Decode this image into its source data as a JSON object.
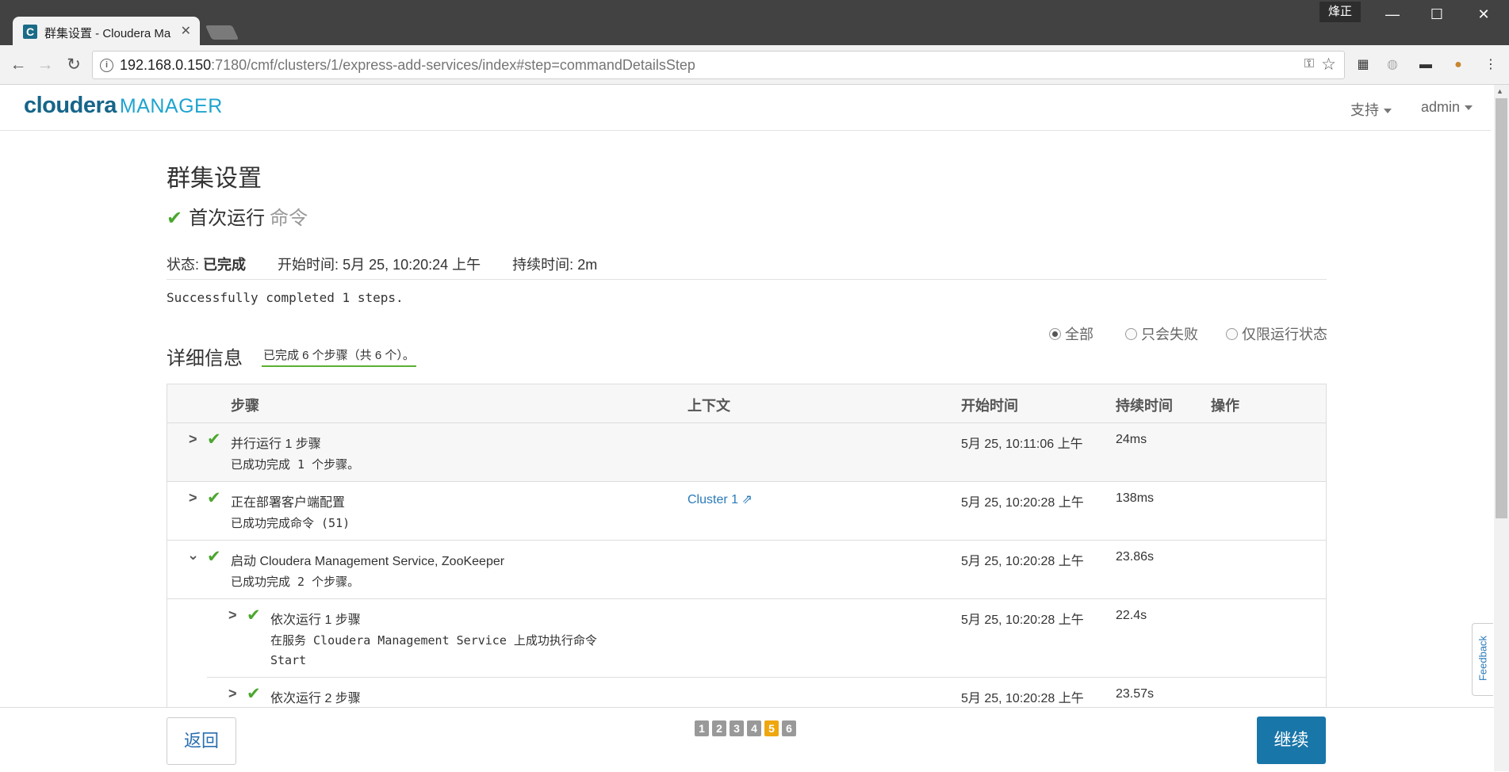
{
  "browser": {
    "tab_title": "群集设置 - Cloudera Ma",
    "profile_name": "烽正",
    "url_host": "192.168.0.150",
    "url_rest": ":7180/cmf/clusters/1/express-add-services/index#step=commandDetailsStep"
  },
  "header": {
    "logo_brand": "cloudera",
    "logo_product": "MANAGER",
    "menu_support": "支持",
    "menu_user": "admin"
  },
  "page": {
    "title": "群集设置",
    "command_name": "首次运行",
    "command_suffix": "命令",
    "status_label": "状态:",
    "status_value": "已完成",
    "start_label": "开始时间:",
    "start_value": "5月 25, 10:20:24 上午",
    "duration_label": "持续时间:",
    "duration_value": "2m",
    "message": "Successfully completed 1 steps."
  },
  "filters": {
    "all": "全部",
    "failed_only": "只会失败",
    "running_only": "仅限运行状态",
    "selected": "all"
  },
  "details": {
    "title": "详细信息",
    "badge": "已完成 6 个步骤（共 6 个）。"
  },
  "table": {
    "columns": {
      "step": "步骤",
      "context": "上下文",
      "start_time": "开始时间",
      "duration": "持续时间",
      "actions": "操作"
    },
    "rows": [
      {
        "name": "并行运行 1 步骤",
        "desc": "已成功完成 1 个步骤。",
        "context": "",
        "start": "5月 25, 10:11:06 上午",
        "duration": "24ms",
        "expanded": false
      },
      {
        "name": "正在部署客户端配置",
        "desc": "已成功完成命令 (51)",
        "context": "Cluster 1",
        "start": "5月 25, 10:20:28 上午",
        "duration": "138ms",
        "expanded": false
      },
      {
        "name": "启动 Cloudera Management Service, ZooKeeper",
        "desc": "已成功完成 2 个步骤。",
        "context": "",
        "start": "5月 25, 10:20:28 上午",
        "duration": "23.86s",
        "expanded": true
      },
      {
        "name": "依次运行 1 步骤",
        "desc": "在服务 Cloudera Management Service 上成功执行命令",
        "desc2": "Start",
        "context": "",
        "start": "5月 25, 10:20:28 上午",
        "duration": "22.4s",
        "expanded": false
      },
      {
        "name": "依次运行 2 步骤",
        "desc": "",
        "context": "",
        "start": "5月 25, 10:20:28 上午",
        "duration": "23.57s",
        "expanded": false
      }
    ]
  },
  "footer": {
    "back": "返回",
    "next": "继续",
    "pages": [
      "1",
      "2",
      "3",
      "4",
      "5",
      "6"
    ],
    "current_page": "5",
    "feedback": "Feedback"
  }
}
